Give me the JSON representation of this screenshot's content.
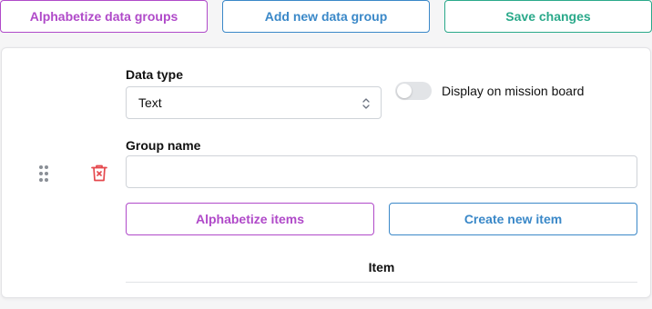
{
  "toolbar": {
    "alphabetize_groups_label": "Alphabetize data groups",
    "add_group_label": "Add new data group",
    "save_label": "Save changes"
  },
  "group": {
    "data_type_label": "Data type",
    "data_type_value": "Text",
    "toggle_label": "Display on mission board",
    "toggle_on": false,
    "group_name_label": "Group name",
    "group_name_value": "",
    "alphabetize_items_label": "Alphabetize items",
    "create_item_label": "Create new item",
    "items_table": {
      "columns": [
        "Item"
      ],
      "rows": []
    }
  },
  "icons": {
    "drag": "drag-handle-icon",
    "delete": "trash-icon",
    "select": "chevron-up-down-icon"
  },
  "colors": {
    "purple": "#b04ac9",
    "blue": "#3a88c8",
    "green": "#2aa98a",
    "danger": "#e5484d"
  }
}
